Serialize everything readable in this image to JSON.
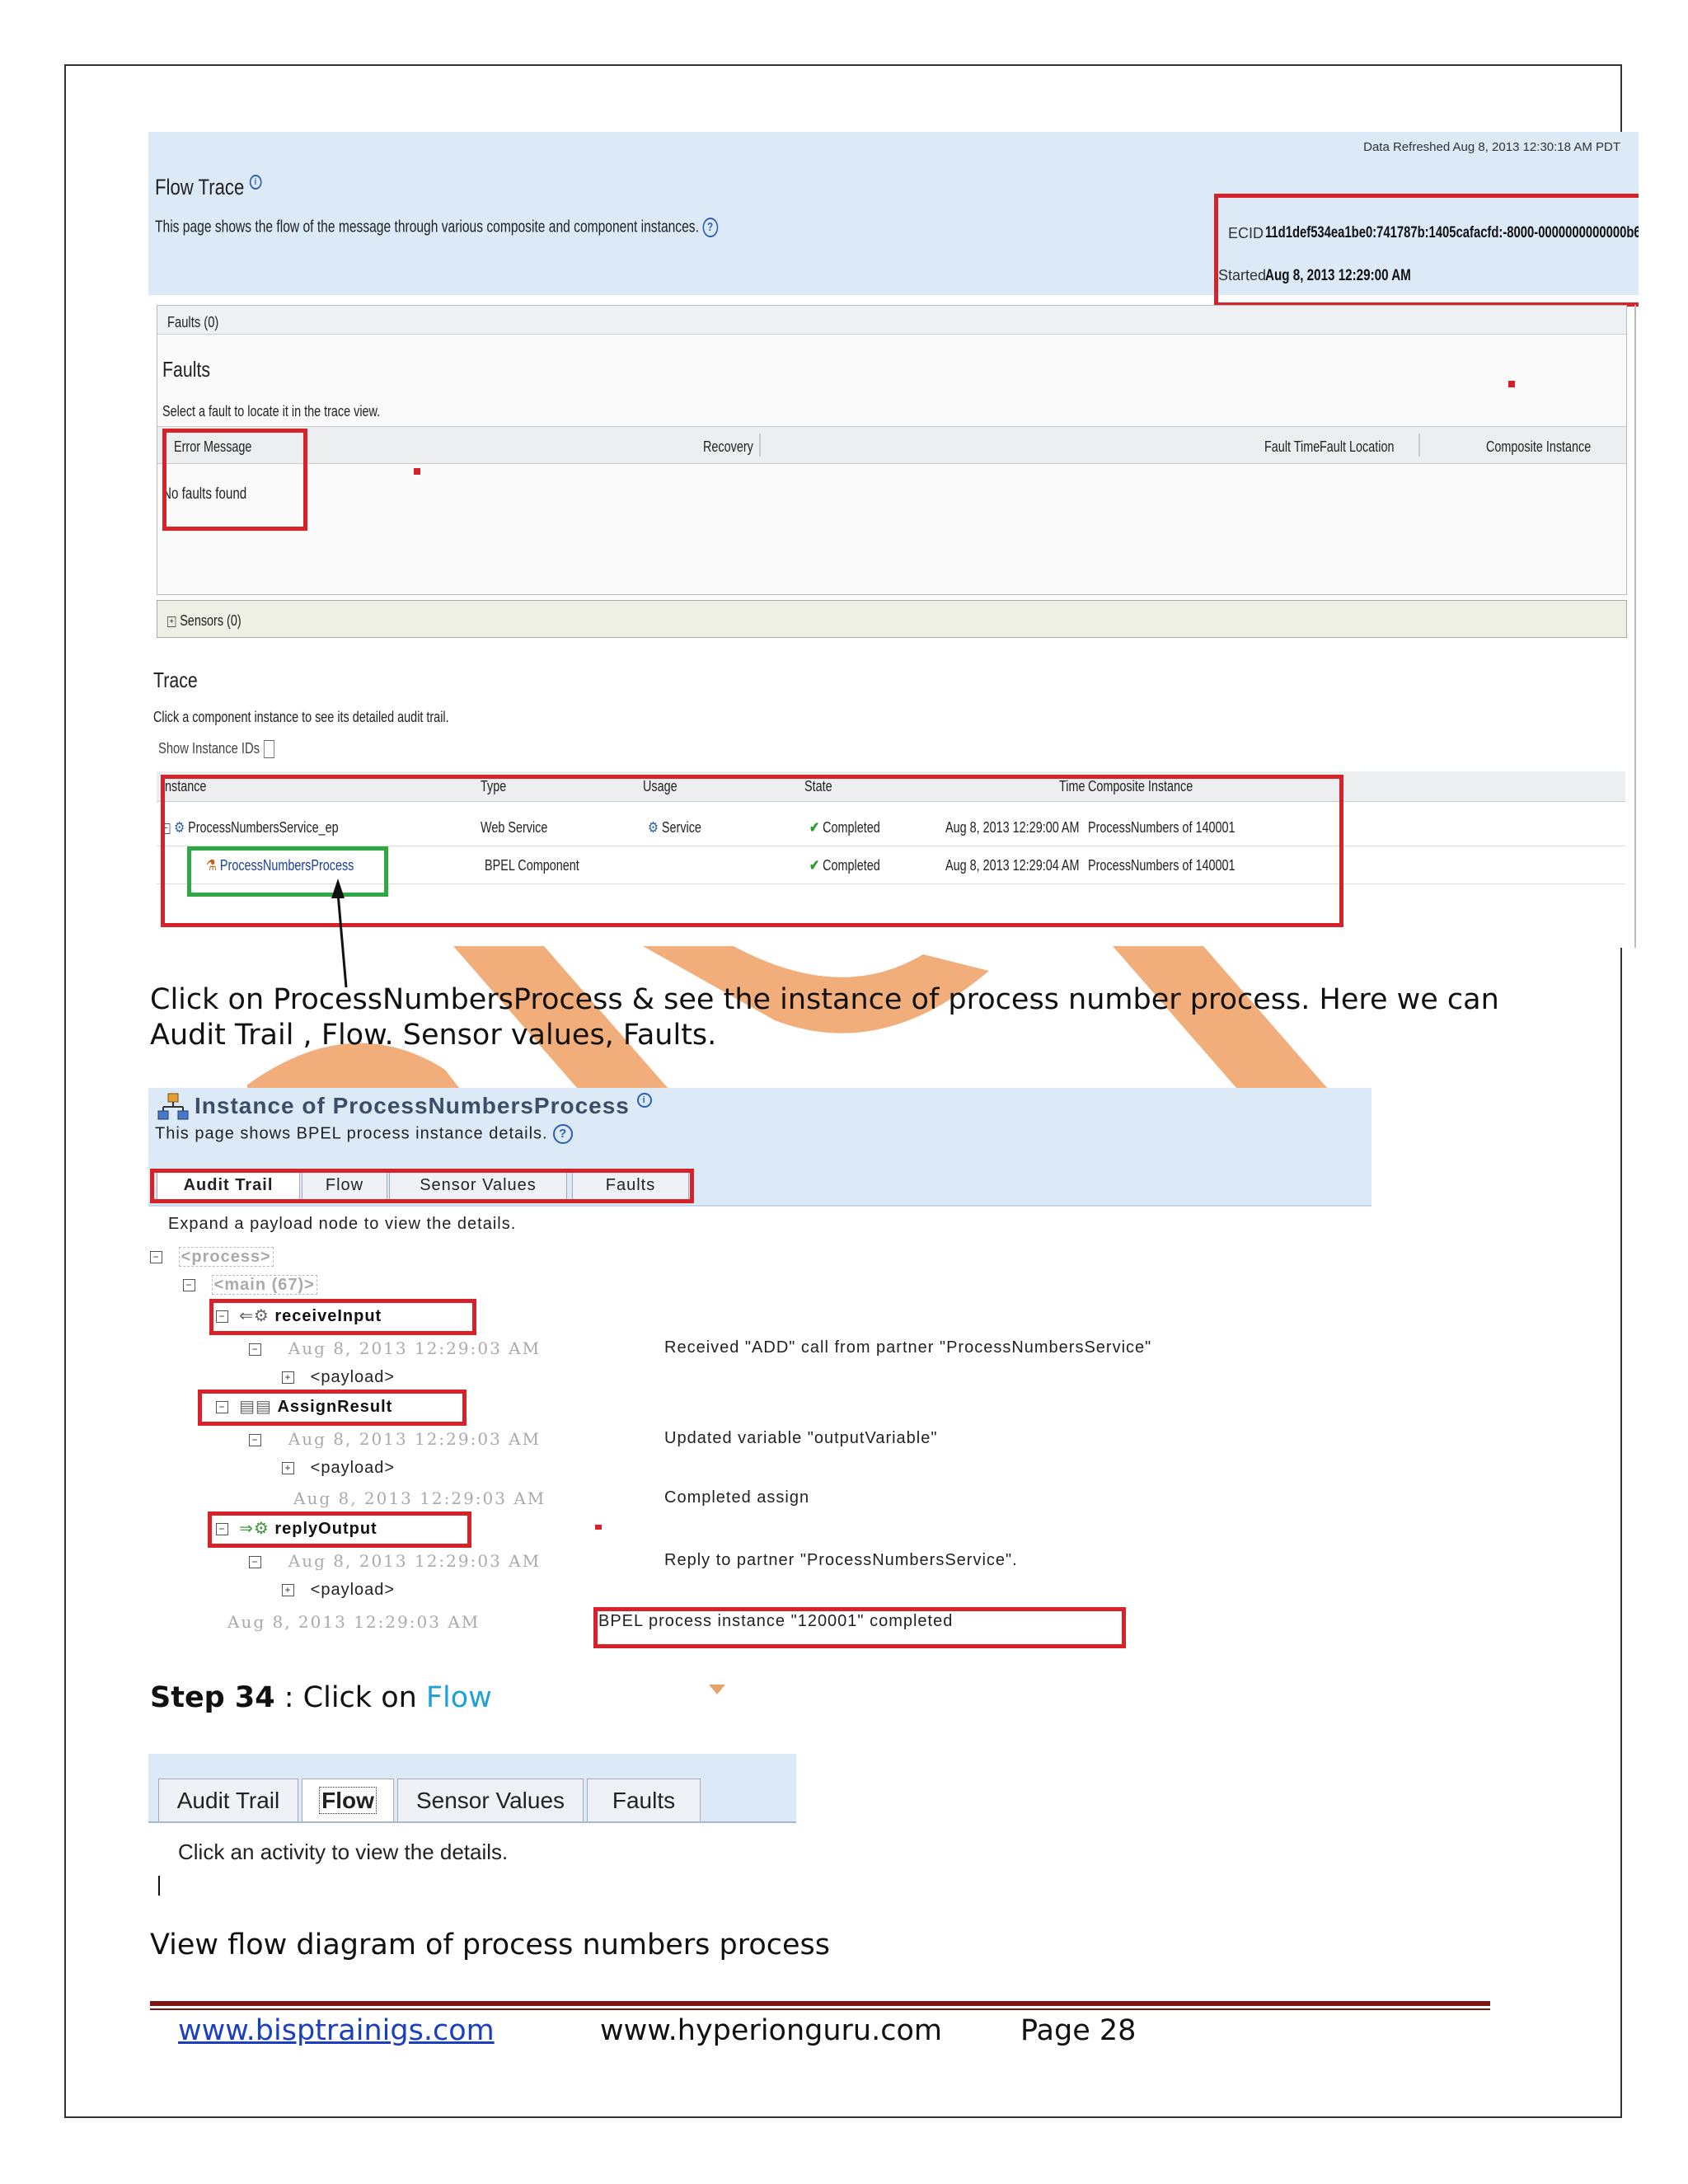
{
  "screenshot1": {
    "refreshed": "Data Refreshed Aug 8, 2013 12:30:18 AM PDT",
    "title": "Flow Trace",
    "description": "This page shows the flow of the message through various composite and component instances.",
    "ecid_label": "ECID",
    "ecid_value": "11d1def534ea1be0:741787b:1405cafacfd:-8000-0000000000000b6",
    "started_label": "Started",
    "started_value": "Aug 8, 2013 12:29:00 AM",
    "faults_tab": "Faults (0)",
    "faults_title": "Faults",
    "faults_select": "Select a fault to locate it in the trace view.",
    "faults_columns": [
      "Error Message",
      "Recovery",
      "Fault Time",
      "Fault Location",
      "Composite Instance"
    ],
    "no_faults": "No faults found",
    "sensors": "Sensors (0)",
    "trace_title": "Trace",
    "trace_desc": "Click a component instance to see its detailed audit trail.",
    "show_ids": "Show Instance IDs",
    "trace_columns": [
      "Instance",
      "Type",
      "Usage",
      "State",
      "Time",
      "Composite Instance"
    ],
    "trace_rows": [
      {
        "instance": "ProcessNumbersService_ep",
        "type": "Web Service",
        "usage": "Service",
        "state": "Completed",
        "time": "Aug 8, 2013 12:29:00 AM",
        "composite": "ProcessNumbers of 140001"
      },
      {
        "instance": "ProcessNumbersProcess",
        "type": "BPEL Component",
        "usage": "",
        "state": "Completed",
        "time": "Aug 8, 2013 12:29:04 AM",
        "composite": "ProcessNumbers of 140001"
      }
    ]
  },
  "paragraph": " Click on ProcessNumbersProcess & see the instance of process number process. Here we can Audit Trail , Flow. Sensor values, Faults.",
  "screenshot2": {
    "title": "Instance of ProcessNumbersProcess",
    "description": "This page shows BPEL process instance details.",
    "tabs": [
      "Audit Trail",
      "Flow",
      "Sensor Values",
      "Faults"
    ],
    "hint": "Expand a payload node to view the details.",
    "process": "<process>",
    "main": "<main (67)>",
    "receive": "receiveInput",
    "assign": "AssignResult",
    "reply": "replyOutput",
    "payload": "<payload>",
    "d1": "Aug 8, 2013 12:29:03 AM",
    "m1": "Received \"ADD\" call from partner \"ProcessNumbersService\"",
    "d2": "Aug 8, 2013 12:29:03 AM",
    "m2": "Updated variable \"outputVariable\"",
    "d3": "Aug 8, 2013 12:29:03 AM",
    "m3": "Completed assign",
    "d4": "Aug 8, 2013 12:29:03 AM",
    "m4": "Reply to partner \"ProcessNumbersService\".",
    "d5": "Aug 8, 2013 12:29:03 AM",
    "m5": "BPEL process instance \"120001\" completed"
  },
  "step": {
    "label": "Step 34",
    "text": " : Click on ",
    "link": "Flow"
  },
  "screenshot3": {
    "tabs": [
      "Audit Trail",
      "Flow",
      "Sensor Values",
      "Faults"
    ],
    "hint": "Click an activity to view the details."
  },
  "caption": "View flow diagram of process numbers process",
  "footer": {
    "site1": "www.bisptrainigs.com",
    "site2": "www.hyperionguru.com",
    "page": "Page 28"
  },
  "colors": {
    "highlight_red": "#d8222a",
    "highlight_green": "#2ea843",
    "watermark": "#f0a46c",
    "footer_rule": "#7a1616"
  }
}
